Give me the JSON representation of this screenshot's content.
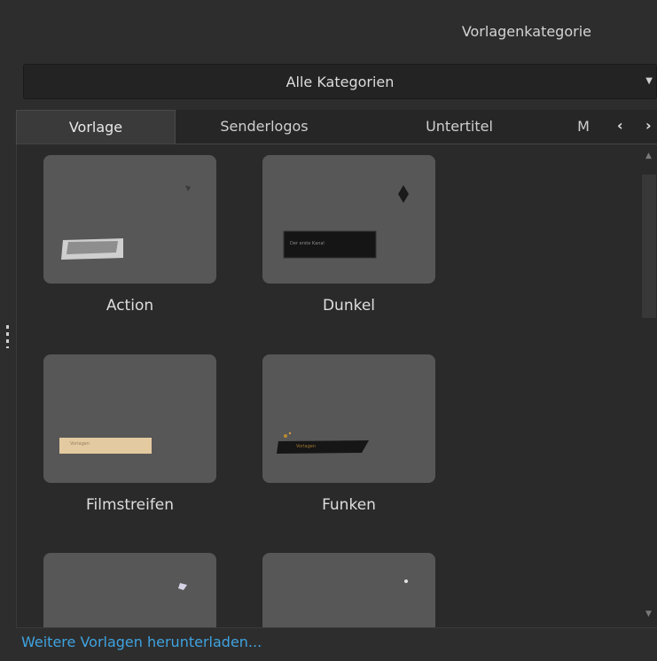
{
  "header": {
    "title": "Vorlagenkategorie"
  },
  "category_select": {
    "value": "Alle Kategorien",
    "caret_icon": "caret-down-icon"
  },
  "tabs": [
    {
      "label": "Vorlage",
      "active": true
    },
    {
      "label": "Senderlogos",
      "active": false
    },
    {
      "label": "Untertitel",
      "active": false
    },
    {
      "label": "M",
      "active": false
    }
  ],
  "tab_nav": {
    "prev": "‹",
    "next": "›"
  },
  "templates": [
    {
      "name": "Action"
    },
    {
      "name": "Dunkel",
      "preview_text": "Der erste Kanal"
    },
    {
      "name": "Filmstreifen",
      "preview_text": "Vorlagen"
    },
    {
      "name": "Funken",
      "preview_text": "Vorlagen"
    },
    {
      "name": ""
    },
    {
      "name": ""
    }
  ],
  "footer": {
    "link": "Weitere Vorlagen herunterladen..."
  },
  "colors": {
    "link": "#3fa3e0",
    "background": "#2d2d2d",
    "tile": "#575757"
  }
}
